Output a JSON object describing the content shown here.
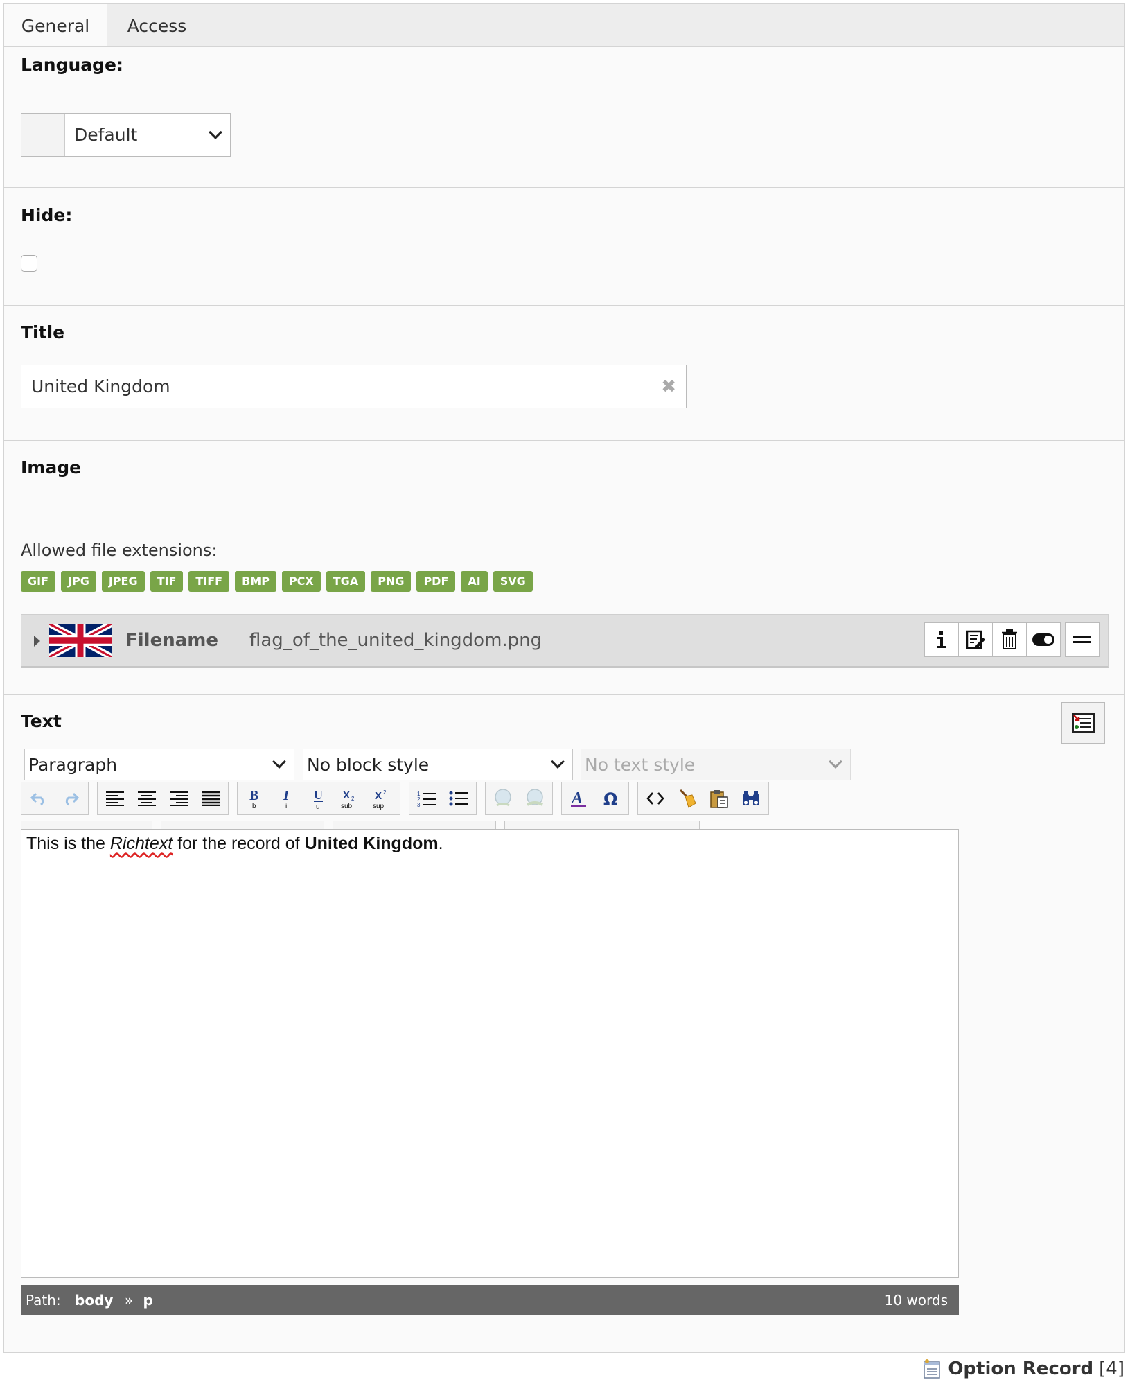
{
  "tabs": [
    "General",
    "Access"
  ],
  "language": {
    "label": "Language:",
    "value": "Default"
  },
  "hide": {
    "label": "Hide:"
  },
  "title": {
    "label": "Title",
    "value": "United Kingdom"
  },
  "image": {
    "label": "Image",
    "allowed_caption": "Allowed file extensions:",
    "extensions": [
      "GIF",
      "JPG",
      "JPEG",
      "TIF",
      "TIFF",
      "BMP",
      "PCX",
      "TGA",
      "PNG",
      "PDF",
      "AI",
      "SVG"
    ],
    "file_label": "Filename",
    "file_value": "flag_of_the_united_kingdom.png"
  },
  "text": {
    "label": "Text",
    "format_select": "Paragraph",
    "block_style_select": "No block style",
    "text_style_select": "No text style",
    "content": {
      "part1": "This is the ",
      "italic": "Richtext",
      "part2": " for the record of ",
      "bold": "United Kingdom",
      "part3": "."
    },
    "path_label": "Path:",
    "path_body": "body",
    "path_sep": "»",
    "path_p": "p",
    "word_count": "10 words"
  },
  "footer": {
    "record_label": "Option Record",
    "record_id": "[4]"
  },
  "colors": {
    "extension_badge": "#79a548",
    "statusbar": "#666666",
    "panel": "#fafafa"
  }
}
